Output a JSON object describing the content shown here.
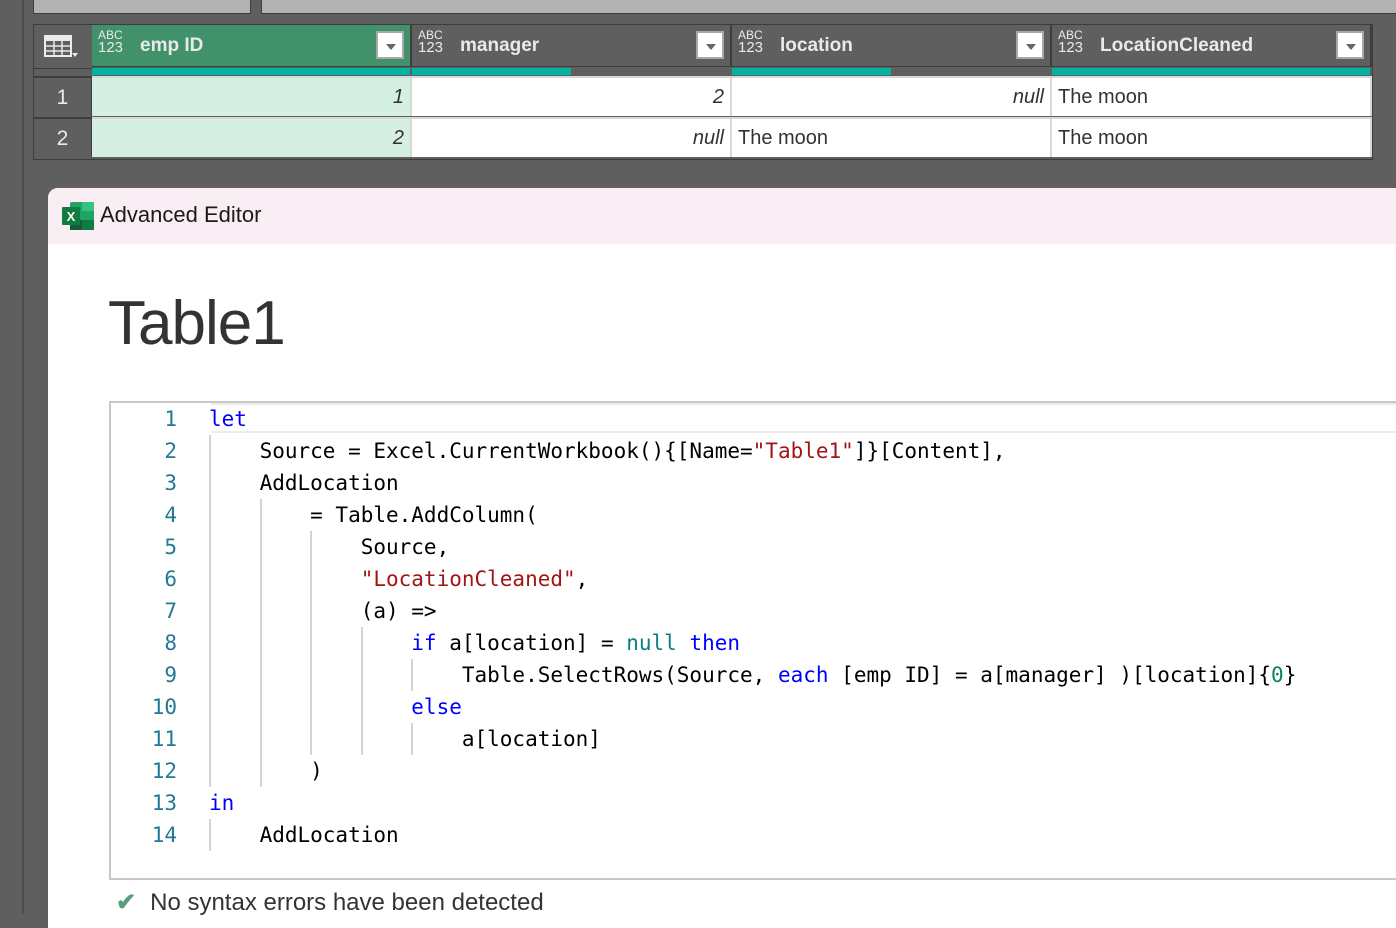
{
  "grid": {
    "columns": [
      {
        "type_top": "ABC",
        "type_bottom": "123",
        "label": "emp ID",
        "selected": true,
        "quality": 1.0
      },
      {
        "type_top": "ABC",
        "type_bottom": "123",
        "label": "manager",
        "selected": false,
        "quality": 0.5
      },
      {
        "type_top": "ABC",
        "type_bottom": "123",
        "label": "location",
        "selected": false,
        "quality": 0.5
      },
      {
        "type_top": "ABC",
        "type_bottom": "123",
        "label": "LocationCleaned",
        "selected": false,
        "quality": 1.0
      }
    ],
    "rows": [
      {
        "num": "1",
        "cells": [
          "1",
          "2",
          "null",
          "The moon"
        ]
      },
      {
        "num": "2",
        "cells": [
          "2",
          "null",
          "The moon",
          "The moon"
        ]
      }
    ]
  },
  "dialog": {
    "title": "Advanced Editor",
    "app_icon": "excel-icon",
    "query_name": "Table1",
    "status": {
      "icon": "check-icon",
      "text": "No syntax errors have been detected"
    },
    "colors": {
      "keyword": "#0000ff",
      "string": "#a31515",
      "number": "#098658",
      "line_number": "#237893"
    },
    "code_lines": [
      {
        "n": "1",
        "tokens": [
          [
            "kw",
            "let"
          ]
        ]
      },
      {
        "n": "2",
        "tokens": [
          [
            "",
            "    Source = Excel.CurrentWorkbook(){[Name="
          ],
          [
            "str",
            "\"Table1\""
          ],
          [
            "",
            "]}[Content],"
          ]
        ]
      },
      {
        "n": "3",
        "tokens": [
          [
            "",
            "    AddLocation"
          ]
        ]
      },
      {
        "n": "4",
        "tokens": [
          [
            "",
            "        = Table.AddColumn("
          ]
        ]
      },
      {
        "n": "5",
        "tokens": [
          [
            "",
            "            Source,"
          ]
        ]
      },
      {
        "n": "6",
        "tokens": [
          [
            "str",
            "            \"LocationCleaned\""
          ],
          [
            "",
            ","
          ]
        ]
      },
      {
        "n": "7",
        "tokens": [
          [
            "",
            "            (a) =>"
          ]
        ]
      },
      {
        "n": "8",
        "tokens": [
          [
            "kw",
            "                if"
          ],
          [
            "",
            " a[location] = "
          ],
          [
            "teal",
            "null"
          ],
          [
            "",
            " "
          ],
          [
            "kw",
            "then"
          ]
        ]
      },
      {
        "n": "9",
        "tokens": [
          [
            "",
            "                    Table.SelectRows(Source, "
          ],
          [
            "kw",
            "each"
          ],
          [
            "",
            " [emp ID] = a[manager] )[location]{"
          ],
          [
            "lit",
            "0"
          ],
          [
            "",
            "}"
          ]
        ]
      },
      {
        "n": "10",
        "tokens": [
          [
            "kw",
            "                else"
          ]
        ]
      },
      {
        "n": "11",
        "tokens": [
          [
            "",
            "                    a[location]"
          ]
        ]
      },
      {
        "n": "12",
        "tokens": [
          [
            "",
            "        )"
          ]
        ]
      },
      {
        "n": "13",
        "tokens": [
          [
            "kw",
            "in"
          ]
        ]
      },
      {
        "n": "14",
        "tokens": [
          [
            "",
            "    AddLocation"
          ]
        ]
      }
    ]
  }
}
